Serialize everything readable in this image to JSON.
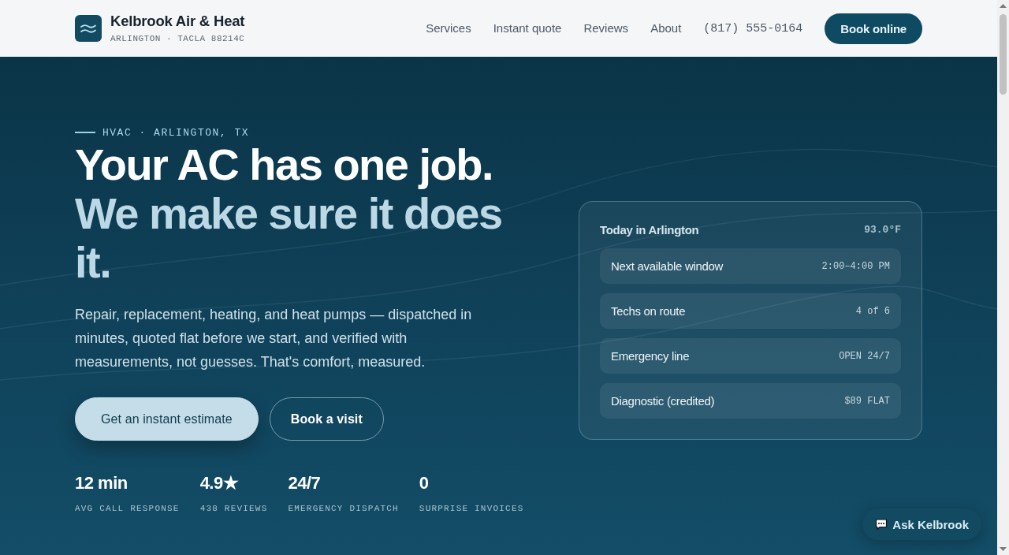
{
  "header": {
    "brand": {
      "name": "Kelbrook Air & Heat",
      "tagline": "ARLINGTON · TACLA 88214C"
    },
    "nav": [
      "Services",
      "Instant quote",
      "Reviews",
      "About"
    ],
    "phone": "(817) 555-0164",
    "cta": "Book online"
  },
  "hero": {
    "eyebrow": "HVAC · ARLINGTON, TX",
    "headline": "Your AC has one job.",
    "headline_accent": "We make sure it does it.",
    "body": "Repair, replacement, heating, and heat pumps — dispatched in minutes, quoted flat before we start, and verified with measurements, not guesses. That's comfort, measured.",
    "buttons": [
      {
        "label": "Get an instant estimate",
        "kind": "primary"
      },
      {
        "label": "Book a visit",
        "kind": "outline"
      }
    ],
    "stats": [
      {
        "value": "12 min",
        "label": "AVG CALL RESPONSE"
      },
      {
        "value": "4.9★",
        "label": "438 REVIEWS"
      },
      {
        "value": "24/7",
        "label": "EMERGENCY DISPATCH"
      },
      {
        "value": "0",
        "label": "SURPRISE INVOICES"
      }
    ]
  },
  "status_card": {
    "title": "Today in Arlington",
    "temperature": "93.0°F",
    "rows": [
      {
        "label": "Next available window",
        "value": "2:00–4:00 PM"
      },
      {
        "label": "Techs on route",
        "value": "4 of 6"
      },
      {
        "label": "Emergency line",
        "value": "OPEN 24/7"
      },
      {
        "label": "Diagnostic (credited)",
        "value": "$89 FLAT"
      }
    ]
  },
  "chat_button": {
    "label": "Ask Kelbrook"
  }
}
